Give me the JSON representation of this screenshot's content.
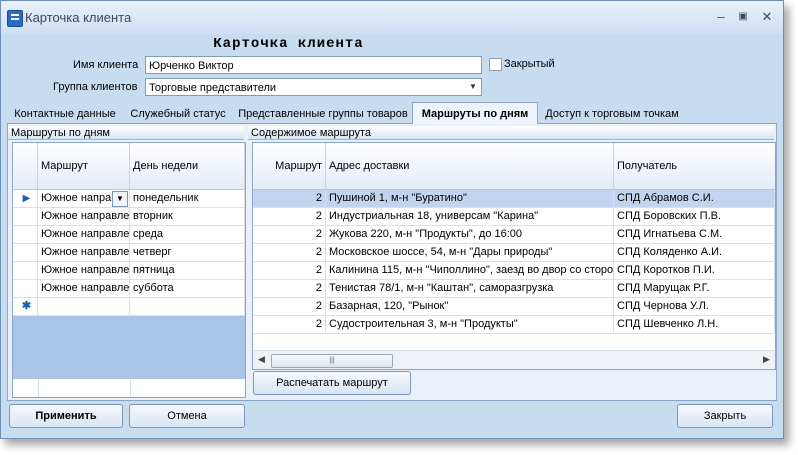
{
  "window": {
    "title": "Карточка клиента"
  },
  "form": {
    "heading": "Карточка клиента",
    "client_name_label": "Имя клиента",
    "client_name_value": "Юрченко Виктор",
    "closed_label": "Закрытый",
    "client_group_label": "Группа клиентов",
    "client_group_value": "Торговые представители"
  },
  "tabs": [
    "Контактные данные",
    "Служебный статус",
    "Представленные группы товаров",
    "Маршруты по дням",
    "Доступ к торговым точкам"
  ],
  "routes": {
    "title": "Маршруты по дням",
    "headers": [
      "Маршрут",
      "День недели"
    ],
    "rows": [
      [
        "Южное напра",
        "понедельник"
      ],
      [
        "Южное направле",
        "вторник"
      ],
      [
        "Южное направле",
        "среда"
      ],
      [
        "Южное направле",
        "четверг"
      ],
      [
        "Южное направле",
        "пятница"
      ],
      [
        "Южное направле",
        "суббота"
      ]
    ]
  },
  "contents": {
    "title": "Содержимое маршрута",
    "headers": [
      "Маршрут",
      "Адрес доставки",
      "Получатель"
    ],
    "rows": [
      [
        "2",
        "Пушиной 1, м-н \"Буратино\"",
        "СПД Абрамов С.И."
      ],
      [
        "2",
        "Индустриальная 18, универсам \"Карина\"",
        "СПД Боровских П.В."
      ],
      [
        "2",
        "Жукова 220, м-н \"Продукты\", до 16:00",
        "СПД Игнатьева С.М."
      ],
      [
        "2",
        "Московское шоссе, 54, м-н \"Дары природы\"",
        "СПД Коляденко А.И."
      ],
      [
        "2",
        "Калинина 115, м-н \"Чиполлино\", заезд во двор со сторо",
        "СПД Коротков П.И."
      ],
      [
        "2",
        "Тенистая 78/1, м-н \"Каштан\", саморазгрузка",
        "СПД Марущак Р.Г."
      ],
      [
        "2",
        "Базарная, 120, \"Рынок\"",
        "СПД Чернова У.Л."
      ],
      [
        "2",
        "Судостроительная 3, м-н \"Продукты\"",
        "СПД Шевченко Л.Н."
      ]
    ],
    "print_button": "Распечатать маршрут"
  },
  "buttons": {
    "apply": "Применить",
    "cancel": "Отмена",
    "close": "Закрыть"
  },
  "colors": {
    "window_bg": "#c8dcf0",
    "selection": "#c3d5ee",
    "accent": "#2b6cc4"
  }
}
